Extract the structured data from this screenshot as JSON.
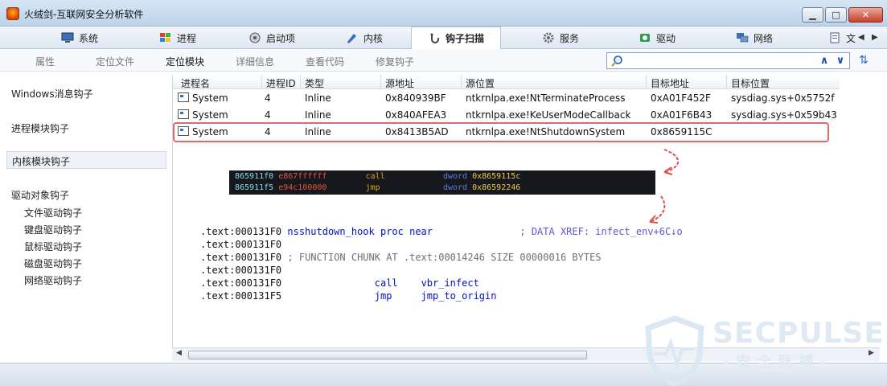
{
  "window": {
    "title": "火绒剑-互联网安全分析软件",
    "min_icon": "minimize-icon",
    "max_icon": "maximize-icon",
    "close_icon": "close-icon"
  },
  "tabs": [
    {
      "label": "系统",
      "icon": "system-icon"
    },
    {
      "label": "进程",
      "icon": "windows-flag-icon"
    },
    {
      "label": "启动项",
      "icon": "startup-icon"
    },
    {
      "label": "内核",
      "icon": "kernel-icon"
    },
    {
      "label": "钩子扫描",
      "icon": "hook-icon",
      "active": true
    },
    {
      "label": "服务",
      "icon": "service-icon"
    },
    {
      "label": "驱动",
      "icon": "driver-icon"
    },
    {
      "label": "网络",
      "icon": "network-icon"
    },
    {
      "label": "文",
      "icon": "file-icon"
    }
  ],
  "subtoolbar": {
    "items": [
      "属性",
      "定位文件",
      "定位模块",
      "详细信息",
      "查看代码",
      "修复钩子"
    ],
    "active": "定位模块",
    "search_value": ""
  },
  "leftnav": {
    "items": [
      "Windows消息钩子",
      "进程模块钩子",
      "内核模块钩子",
      "驱动对象钩子"
    ],
    "selected": "内核模块钩子",
    "subitems": [
      "文件驱动钩子",
      "键盘驱动钩子",
      "鼠标驱动钩子",
      "磁盘驱动钩子",
      "网络驱动钩子"
    ]
  },
  "table": {
    "headers": [
      "进程名",
      "进程ID",
      "类型",
      "源地址",
      "源位置",
      "目标地址",
      "目标位置"
    ],
    "rows": [
      [
        "System",
        "4",
        "Inline",
        "0x840939BF",
        "ntkrnlpa.exe!NtTerminateProcess",
        "0xA01F452F",
        "sysdiag.sys+0x5752f"
      ],
      [
        "System",
        "4",
        "Inline",
        "0x840AFEA3",
        "ntkrnlpa.exe!KeUserModeCallback",
        "0xA01F6B43",
        "sysdiag.sys+0x59b43"
      ],
      [
        "System",
        "4",
        "Inline",
        "0x8413B5AD",
        "ntkrnlpa.exe!NtShutdownSystem",
        "0x8659115C",
        ""
      ]
    ],
    "highlighted_row": 2
  },
  "disasm": [
    {
      "addr": "865911f0",
      "bytes": "e867ffffff",
      "mnemonic": "call",
      "kw": "dword",
      "operand": "0x8659115c"
    },
    {
      "addr": "865911f5",
      "bytes": "e94c100000",
      "mnemonic": "jmp",
      "kw": "dword",
      "operand": "0x86592246"
    }
  ],
  "code": [
    {
      "addr": ".text:000131F0",
      "rest": " nsshutdown_hook proc near",
      "comment": "; DATA XREF: infect_env+6C↓o"
    },
    {
      "addr": ".text:000131F0",
      "rest": "",
      "comment": ""
    },
    {
      "addr": ".text:000131F0",
      "rest": "",
      "comment": "; FUNCTION CHUNK AT .text:00014246 SIZE 00000016 BYTES"
    },
    {
      "addr": ".text:000131F0",
      "rest": "",
      "comment": ""
    },
    {
      "addr": ".text:000131F0",
      "mn": "call",
      "op": "vbr_infect"
    },
    {
      "addr": ".text:000131F5",
      "mn": "jmp",
      "op": "jmp_to_origin"
    }
  ],
  "watermark": {
    "title": "SECPULSE",
    "subtitle": "-安全脉搏-"
  },
  "colors": {
    "highlight": "#e06a6a",
    "arrow": "#e05050"
  }
}
